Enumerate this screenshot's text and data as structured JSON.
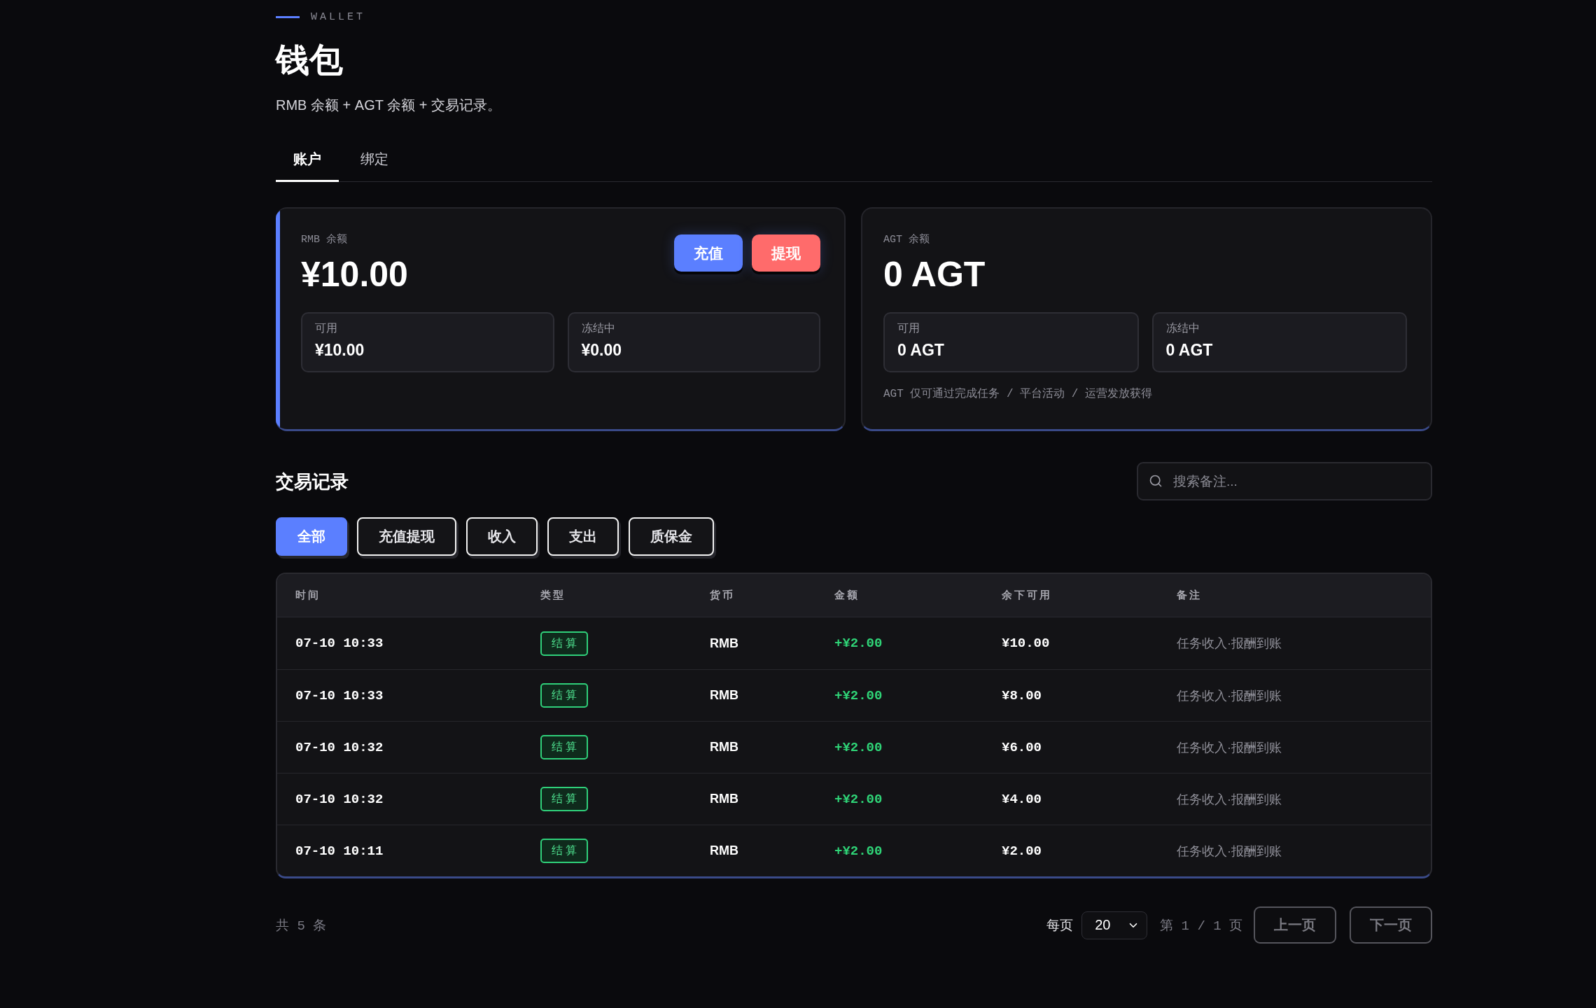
{
  "header": {
    "eyebrow": "WALLET",
    "title": "钱包",
    "subtitle": "RMB 余额 + AGT 余额 + 交易记录。"
  },
  "tabs": [
    {
      "label": "账户",
      "selected": true
    },
    {
      "label": "绑定",
      "selected": false
    }
  ],
  "balance_cards": [
    {
      "label": "RMB 余额",
      "amount": "¥10.00",
      "highlighted": true,
      "actions": [
        {
          "label": "充值",
          "kind": "primary"
        },
        {
          "label": "提现",
          "kind": "danger"
        }
      ],
      "sub_balances": [
        {
          "label": "可用",
          "value": "¥10.00"
        },
        {
          "label": "冻结中",
          "value": "¥0.00"
        }
      ]
    },
    {
      "label": "AGT 余额",
      "amount": "0 AGT",
      "highlighted": false,
      "sub_balances": [
        {
          "label": "可用",
          "value": "0 AGT"
        },
        {
          "label": "冻结中",
          "value": "0 AGT"
        }
      ],
      "note": "AGT 仅可通过完成任务 / 平台活动 / 运营发放获得"
    }
  ],
  "transactions": {
    "title": "交易记录",
    "search": {
      "placeholder": "搜索备注..."
    },
    "filters": [
      {
        "label": "全部",
        "selected": true
      },
      {
        "label": "充值提现",
        "selected": false
      },
      {
        "label": "收入",
        "selected": false
      },
      {
        "label": "支出",
        "selected": false
      },
      {
        "label": "质保金",
        "selected": false
      }
    ],
    "table": {
      "columns": [
        "时间",
        "类型",
        "货币",
        "金额",
        "余下可用",
        "备注"
      ],
      "rows": [
        {
          "time": "07-10 10:33",
          "type": "结算",
          "currency": "RMB",
          "amount": "+¥2.00",
          "credit": true,
          "remaining": "¥10.00",
          "note": "任务收入·报酬到账"
        },
        {
          "time": "07-10 10:33",
          "type": "结算",
          "currency": "RMB",
          "amount": "+¥2.00",
          "credit": true,
          "remaining": "¥8.00",
          "note": "任务收入·报酬到账"
        },
        {
          "time": "07-10 10:32",
          "type": "结算",
          "currency": "RMB",
          "amount": "+¥2.00",
          "credit": true,
          "remaining": "¥6.00",
          "note": "任务收入·报酬到账"
        },
        {
          "time": "07-10 10:32",
          "type": "结算",
          "currency": "RMB",
          "amount": "+¥2.00",
          "credit": true,
          "remaining": "¥4.00",
          "note": "任务收入·报酬到账"
        },
        {
          "time": "07-10 10:11",
          "type": "结算",
          "currency": "RMB",
          "amount": "+¥2.00",
          "credit": true,
          "remaining": "¥2.00",
          "note": "任务收入·报酬到账"
        }
      ]
    },
    "pagination": {
      "total": "共 5 条",
      "page_size_label": "每页",
      "page_size": "20",
      "page_info": "第 1 / 1 页",
      "prev": {
        "label": "上一页",
        "disabled": true
      },
      "next": {
        "label": "下一页",
        "disabled": true
      }
    }
  }
}
